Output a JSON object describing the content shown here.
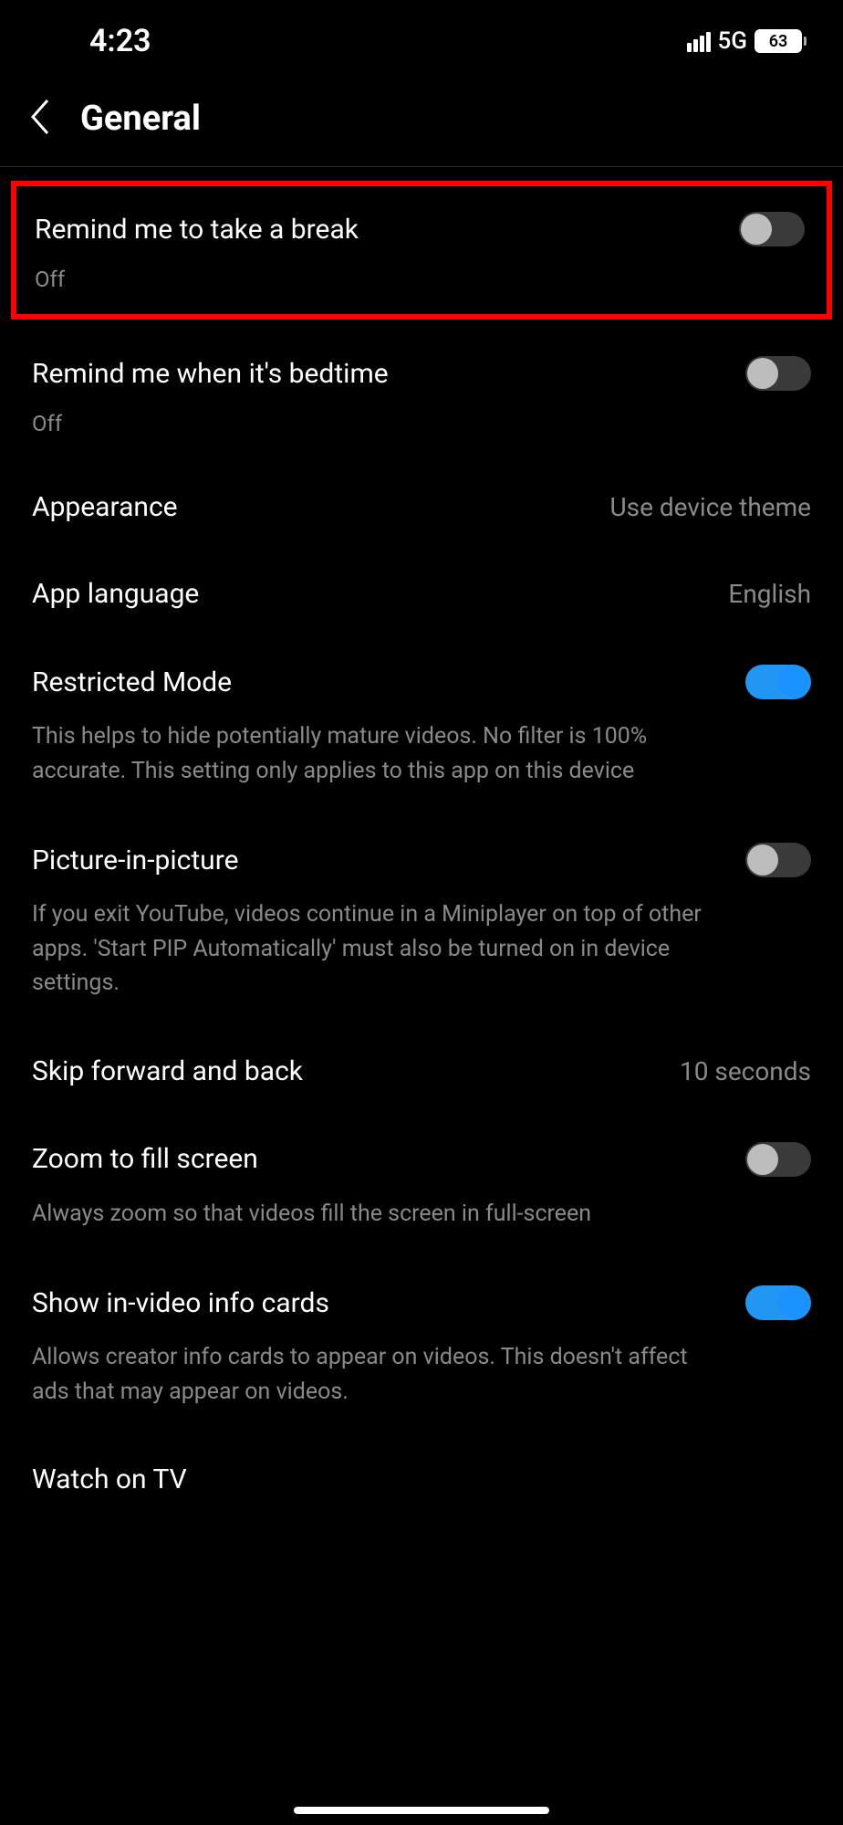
{
  "status_bar": {
    "time": "4:23",
    "network_type": "5G",
    "battery_level": "63"
  },
  "header": {
    "title": "General"
  },
  "settings": {
    "take_break": {
      "label": "Remind me to take a break",
      "status": "Off"
    },
    "bedtime": {
      "label": "Remind me when it's bedtime",
      "status": "Off"
    },
    "appearance": {
      "label": "Appearance",
      "value": "Use device theme"
    },
    "app_language": {
      "label": "App language",
      "value": "English"
    },
    "restricted_mode": {
      "label": "Restricted Mode",
      "description": "This helps to hide potentially mature videos. No filter is 100% accurate. This setting only applies to this app on this device"
    },
    "picture_in_picture": {
      "label": "Picture-in-picture",
      "description": "If you exit YouTube, videos continue in a Miniplayer on top of other apps. 'Start PIP Automatically' must also be turned on in device settings."
    },
    "skip": {
      "label": "Skip forward and back",
      "value": "10 seconds"
    },
    "zoom_fill": {
      "label": "Zoom to fill screen",
      "description": "Always zoom so that videos fill the screen in full-screen"
    },
    "info_cards": {
      "label": "Show in-video info cards",
      "description": "Allows creator info cards to appear on videos. This doesn't affect ads that may appear on videos."
    },
    "watch_tv": {
      "label": "Watch on TV"
    }
  }
}
